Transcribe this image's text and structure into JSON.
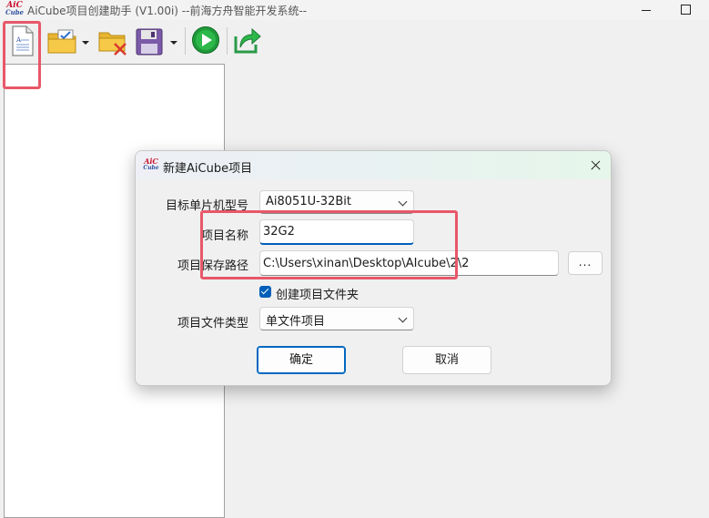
{
  "window": {
    "logo_top": "AiC",
    "logo_bottom": "Cube",
    "title": "AiCube项目创建助手 (V1.00i) --前海方舟智能开发系统--"
  },
  "toolbar": {
    "buttons": [
      {
        "name": "new-project",
        "icon": "new-document-icon"
      },
      {
        "name": "open-project",
        "icon": "open-folder-icon",
        "has_dropdown": true
      },
      {
        "name": "close-project",
        "icon": "close-folder-icon"
      },
      {
        "name": "save-project",
        "icon": "floppy-disk-icon",
        "has_dropdown": true
      },
      {
        "name": "run",
        "icon": "play-icon"
      },
      {
        "name": "export",
        "icon": "share-arrow-icon"
      }
    ]
  },
  "dialog": {
    "logo_top": "AiC",
    "logo_bottom": "Cube",
    "title": "新建AiCube项目",
    "mcu_label": "目标单片机型号",
    "mcu_value": "Ai8051U-32Bit",
    "name_label": "项目名称",
    "name_value": "32G2",
    "path_label": "项目保存路径",
    "path_value": "C:\\Users\\xinan\\Desktop\\AIcube\\2\\2",
    "browse_label": "...",
    "create_folder_label": "创建项目文件夹",
    "create_folder_checked": true,
    "filetype_label": "项目文件类型",
    "filetype_value": "单文件项目",
    "ok_label": "确定",
    "cancel_label": "取消"
  },
  "colors": {
    "accent": "#005fb8",
    "highlight": "#e8576a",
    "logo_red": "#c8102e",
    "logo_blue": "#2f4fa0"
  }
}
